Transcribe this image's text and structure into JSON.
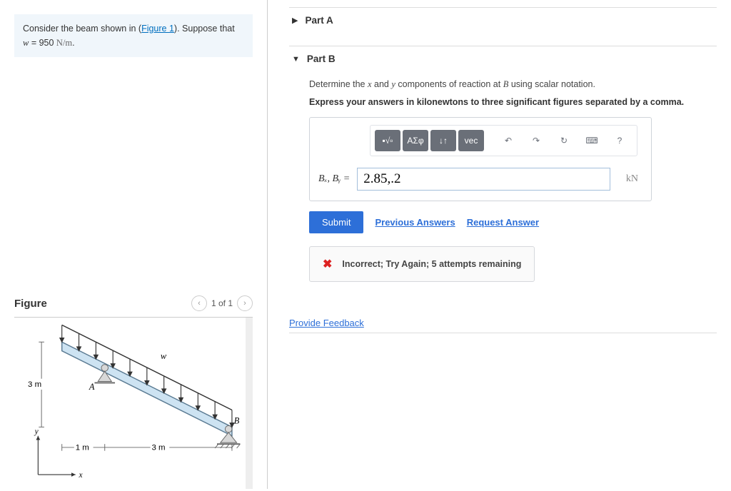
{
  "problem": {
    "prefix": "Consider the beam shown in (",
    "figure_link": "Figure 1",
    "suffix": "). Suppose that ",
    "var": "w",
    "equals": " = 950 ",
    "unit": "N/m",
    "period": "."
  },
  "figure": {
    "title": "Figure",
    "pager": "1 of 1",
    "labels": {
      "h": "3 m",
      "d1": "1 m",
      "d2": "3 m",
      "w": "w",
      "A": "A",
      "B": "B",
      "x": "x",
      "y": "y"
    }
  },
  "partA": {
    "label": "Part A"
  },
  "partB": {
    "label": "Part B",
    "q_before": "Determine the ",
    "q_x": "x",
    "q_mid": " and ",
    "q_y": "y",
    "q_mid2": " components of reaction at ",
    "q_B": "B",
    "q_after": " using scalar notation.",
    "instruction": "Express your answers in kilonewtons to three significant figures separated by a comma.",
    "toolbar": {
      "greek": "ΑΣφ",
      "sub": "↓↑",
      "vec": "vec",
      "undo": "↶",
      "redo": "↷",
      "reset": "↻",
      "kbd": "⌨",
      "help": "?"
    },
    "input_label": "Bₓ, Bᵧ = ",
    "input_value": "2.85,.2",
    "unit": "kN",
    "submit": "Submit",
    "prev": "Previous Answers",
    "request": "Request Answer",
    "feedback_text": "Incorrect; Try Again; 5 attempts remaining"
  },
  "provide_feedback": "Provide Feedback"
}
